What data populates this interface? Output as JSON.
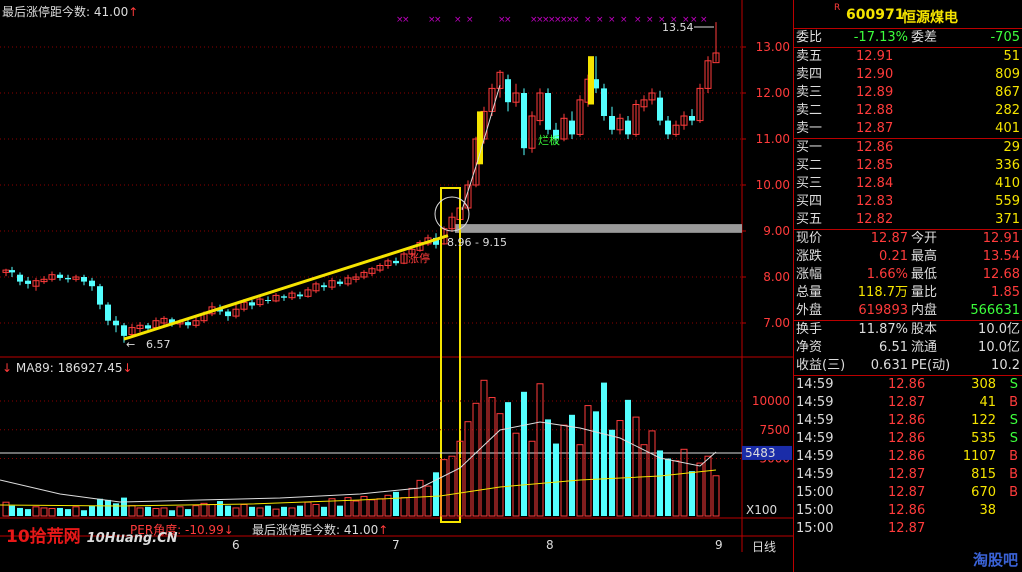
{
  "main_chart": {
    "title": "最后涨停距今数: 41.00",
    "title_arrow": "↑",
    "price_ticks": [
      "13.00",
      "12.00",
      "11.00",
      "10.00",
      "9.00",
      "8.00",
      "7.00"
    ],
    "low_label": "6.57",
    "high_label": "13.54",
    "range_label": "8.96 - 9.15",
    "board_label": "烂板",
    "stage_label": "涨停"
  },
  "volume_chart": {
    "title": "MA89: 186927.45",
    "title_arrow": "↓",
    "vol_ticks": [
      "10000",
      "7500",
      "5000"
    ],
    "highlight_value": "5483",
    "multiplier": "X100"
  },
  "indicator": {
    "label": "PER角度: -10.99",
    "arrow": "↓",
    "label2": "最后涨停距今数: 41.00",
    "arrow2": "↑"
  },
  "date_axis": [
    "6",
    "7",
    "8",
    "9"
  ],
  "period": "日线",
  "watermark": {
    "brand": "10拾荒网",
    "url": "10Huang.CN"
  },
  "stock": {
    "badge": "R",
    "code": "600971",
    "name": "恒源煤电"
  },
  "order_book": {
    "wei_bi_label": "委比",
    "wei_bi": "-17.13%",
    "wei_cha_label": "委差",
    "wei_cha": "-705",
    "asks": [
      {
        "label": "卖五",
        "price": "12.91",
        "vol": "51"
      },
      {
        "label": "卖四",
        "price": "12.90",
        "vol": "809"
      },
      {
        "label": "卖三",
        "price": "12.89",
        "vol": "867"
      },
      {
        "label": "卖二",
        "price": "12.88",
        "vol": "282"
      },
      {
        "label": "卖一",
        "price": "12.87",
        "vol": "401"
      }
    ],
    "bids": [
      {
        "label": "买一",
        "price": "12.86",
        "vol": "29"
      },
      {
        "label": "买二",
        "price": "12.85",
        "vol": "336"
      },
      {
        "label": "买三",
        "price": "12.84",
        "vol": "410"
      },
      {
        "label": "买四",
        "price": "12.83",
        "vol": "559"
      },
      {
        "label": "买五",
        "price": "12.82",
        "vol": "371"
      }
    ]
  },
  "quote": [
    {
      "l1": "现价",
      "v1": "12.87",
      "l2": "今开",
      "v2": "12.91"
    },
    {
      "l1": "涨跌",
      "v1": "0.21",
      "l2": "最高",
      "v2": "13.54"
    },
    {
      "l1": "涨幅",
      "v1": "1.66%",
      "l2": "最低",
      "v2": "12.68"
    },
    {
      "l1": "总量",
      "v1": "118.7万",
      "l2": "量比",
      "v2": "1.85"
    },
    {
      "l1": "外盘",
      "v1": "619893",
      "l2": "内盘",
      "v2": "566631"
    }
  ],
  "fundamentals": [
    {
      "l1": "换手",
      "v1": "11.87%",
      "l2": "股本",
      "v2": "10.0亿"
    },
    {
      "l1": "净资",
      "v1": "6.51",
      "l2": "流通",
      "v2": "10.0亿"
    },
    {
      "l1": "收益(三)",
      "v1": "0.631",
      "l2": "PE(动)",
      "v2": "10.2"
    }
  ],
  "trades": [
    {
      "time": "14:59",
      "price": "12.86",
      "vol": "308",
      "side": "S"
    },
    {
      "time": "14:59",
      "price": "12.87",
      "vol": "41",
      "side": "B"
    },
    {
      "time": "14:59",
      "price": "12.86",
      "vol": "122",
      "side": "S"
    },
    {
      "time": "14:59",
      "price": "12.86",
      "vol": "535",
      "side": "S"
    },
    {
      "time": "14:59",
      "price": "12.86",
      "vol": "1107",
      "side": "B"
    },
    {
      "time": "14:59",
      "price": "12.87",
      "vol": "815",
      "side": "B"
    },
    {
      "time": "15:00",
      "price": "12.87",
      "vol": "670",
      "side": "B"
    },
    {
      "time": "15:00",
      "price": "12.86",
      "vol": "38",
      "side": ""
    },
    {
      "time": "15:00",
      "price": "12.87",
      "vol": "",
      "side": ""
    }
  ],
  "brand_corner": "淘股吧",
  "colors": {
    "up": "#ff3b3b",
    "down": "#54ffff",
    "ma_yellow": "#f5e400",
    "ma_white": "#dddddd",
    "box": "#f5e400",
    "grid": "#8b0000"
  }
}
